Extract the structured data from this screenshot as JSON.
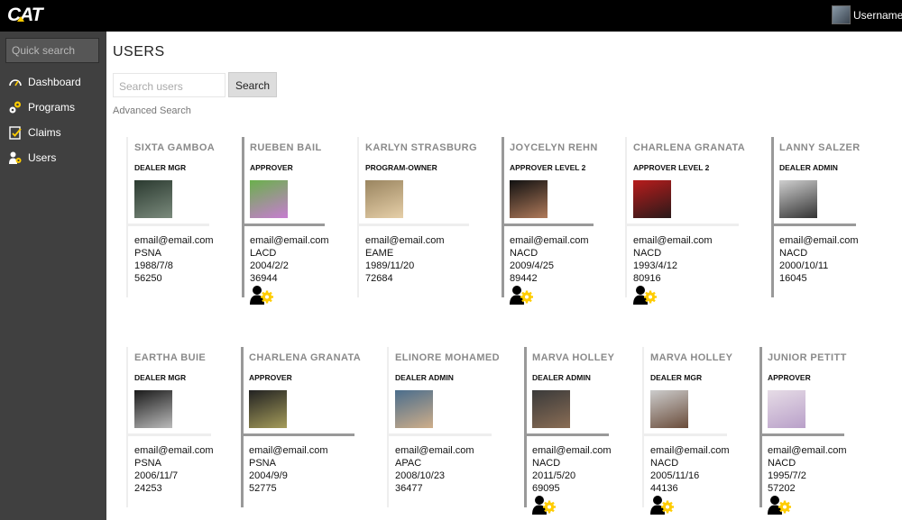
{
  "header": {
    "logo": "CAT",
    "username": "Username"
  },
  "sidebar": {
    "quick_search_placeholder": "Quick search",
    "items": [
      {
        "label": "Dashboard",
        "icon": "gauge-icon"
      },
      {
        "label": "Programs",
        "icon": "gears-icon"
      },
      {
        "label": "Claims",
        "icon": "checklist-icon"
      },
      {
        "label": "Users",
        "icon": "users-icon"
      }
    ]
  },
  "main": {
    "title": "USERS",
    "search_placeholder": "Search users",
    "search_button": "Search",
    "advanced_search": "Advanced Search"
  },
  "users": [
    {
      "name": "SIXTA GAMBOA",
      "role": "DEALER MGR",
      "email": "email@email.com",
      "region": "PSNA",
      "date": "1988/7/8",
      "id": "56250",
      "admin": false
    },
    {
      "name": "RUEBEN BAIL",
      "role": "APPROVER",
      "email": "email@email.com",
      "region": "LACD",
      "date": "2004/2/2",
      "id": "36944",
      "admin": true
    },
    {
      "name": "KARLYN STRASBURG",
      "role": "PROGRAM-OWNER",
      "email": "email@email.com",
      "region": "EAME",
      "date": "1989/11/20",
      "id": "72684",
      "admin": false
    },
    {
      "name": "JOYCELYN REHN",
      "role": "APPROVER LEVEL 2",
      "email": "email@email.com",
      "region": "NACD",
      "date": "2009/4/25",
      "id": "89442",
      "admin": true
    },
    {
      "name": "CHARLENA GRANATA",
      "role": "APPROVER LEVEL 2",
      "email": "email@email.com",
      "region": "NACD",
      "date": "1993/4/12",
      "id": "80916",
      "admin": true
    },
    {
      "name": "LANNY SALZER",
      "role": "DEALER ADMIN",
      "email": "email@email.com",
      "region": "NACD",
      "date": "2000/10/11",
      "id": "16045",
      "admin": false
    },
    {
      "name": "EARTHA BUIE",
      "role": "DEALER MGR",
      "email": "email@email.com",
      "region": "PSNA",
      "date": "2006/11/7",
      "id": "24253",
      "admin": false
    },
    {
      "name": "CHARLENA GRANATA",
      "role": "APPROVER",
      "email": "email@email.com",
      "region": "PSNA",
      "date": "2004/9/9",
      "id": "52775",
      "admin": false
    },
    {
      "name": "ELINORE MOHAMED",
      "role": "DEALER ADMIN",
      "email": "email@email.com",
      "region": "APAC",
      "date": "2008/10/23",
      "id": "36477",
      "admin": false
    },
    {
      "name": "MARVA HOLLEY",
      "role": "DEALER ADMIN",
      "email": "email@email.com",
      "region": "NACD",
      "date": "2011/5/20",
      "id": "69095",
      "admin": true
    },
    {
      "name": "MARVA HOLLEY",
      "role": "DEALER MGR",
      "email": "email@email.com",
      "region": "NACD",
      "date": "2005/11/16",
      "id": "44136",
      "admin": true
    },
    {
      "name": "JUNIOR PETITT",
      "role": "APPROVER",
      "email": "email@email.com",
      "region": "NACD",
      "date": "1995/7/2",
      "id": "57202",
      "admin": true
    }
  ]
}
